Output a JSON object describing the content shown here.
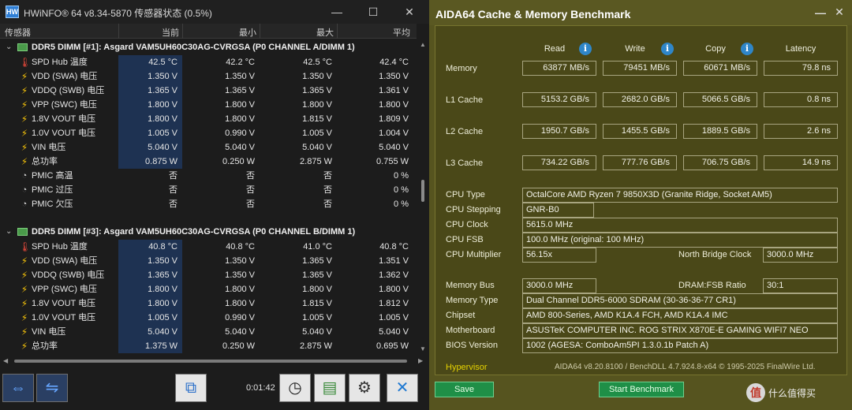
{
  "hwinfo": {
    "title": "HWiNFO® 64 v8.34-5870 传感器状态 (0.5%)",
    "logo_text": "HW",
    "window_controls": [
      "—",
      "☐",
      "✕"
    ],
    "columns": [
      "传感器",
      "当前",
      "最小",
      "最大",
      "平均"
    ],
    "groups": [
      {
        "toggle": "⌄",
        "name": "DDR5 DIMM [#1]: Asgard VAM5UH60C30AG-CVRGSA (P0 CHANNEL A/DIMM 1)",
        "rows": [
          {
            "icon": "thermometer-icon",
            "label": "SPD Hub 温度",
            "cur": "42.5 °C",
            "min": "42.2 °C",
            "max": "42.5 °C",
            "avg": "42.4 °C"
          },
          {
            "icon": "bolt-icon",
            "label": "VDD (SWA) 电压",
            "cur": "1.350 V",
            "min": "1.350 V",
            "max": "1.350 V",
            "avg": "1.350 V"
          },
          {
            "icon": "bolt-icon",
            "label": "VDDQ (SWB) 电压",
            "cur": "1.365 V",
            "min": "1.365 V",
            "max": "1.365 V",
            "avg": "1.361 V"
          },
          {
            "icon": "bolt-icon",
            "label": "VPP (SWC) 电压",
            "cur": "1.800 V",
            "min": "1.800 V",
            "max": "1.800 V",
            "avg": "1.800 V"
          },
          {
            "icon": "bolt-icon",
            "label": "1.8V VOUT 电压",
            "cur": "1.800 V",
            "min": "1.800 V",
            "max": "1.815 V",
            "avg": "1.809 V"
          },
          {
            "icon": "bolt-icon",
            "label": "1.0V VOUT 电压",
            "cur": "1.005 V",
            "min": "0.990 V",
            "max": "1.005 V",
            "avg": "1.004 V"
          },
          {
            "icon": "bolt-icon",
            "label": "VIN 电压",
            "cur": "5.040 V",
            "min": "5.040 V",
            "max": "5.040 V",
            "avg": "5.040 V"
          },
          {
            "icon": "bolt-icon",
            "label": "总功率",
            "cur": "0.875 W",
            "min": "0.250 W",
            "max": "2.875 W",
            "avg": "0.755 W"
          },
          {
            "icon": "clock-icon",
            "label": "PMIC 高温",
            "cur": "否",
            "min": "否",
            "max": "否",
            "avg": "0 %"
          },
          {
            "icon": "clock-icon",
            "label": "PMIC 过压",
            "cur": "否",
            "min": "否",
            "max": "否",
            "avg": "0 %"
          },
          {
            "icon": "clock-icon",
            "label": "PMIC 欠压",
            "cur": "否",
            "min": "否",
            "max": "否",
            "avg": "0 %"
          }
        ]
      },
      {
        "toggle": "⌄",
        "name": "DDR5 DIMM [#3]: Asgard VAM5UH60C30AG-CVRGSA (P0 CHANNEL B/DIMM 1)",
        "rows": [
          {
            "icon": "thermometer-icon",
            "label": "SPD Hub 温度",
            "cur": "40.8 °C",
            "min": "40.8 °C",
            "max": "41.0 °C",
            "avg": "40.8 °C"
          },
          {
            "icon": "bolt-icon",
            "label": "VDD (SWA) 电压",
            "cur": "1.350 V",
            "min": "1.350 V",
            "max": "1.365 V",
            "avg": "1.351 V"
          },
          {
            "icon": "bolt-icon",
            "label": "VDDQ (SWB) 电压",
            "cur": "1.365 V",
            "min": "1.350 V",
            "max": "1.365 V",
            "avg": "1.362 V"
          },
          {
            "icon": "bolt-icon",
            "label": "VPP (SWC) 电压",
            "cur": "1.800 V",
            "min": "1.800 V",
            "max": "1.800 V",
            "avg": "1.800 V"
          },
          {
            "icon": "bolt-icon",
            "label": "1.8V VOUT 电压",
            "cur": "1.800 V",
            "min": "1.800 V",
            "max": "1.815 V",
            "avg": "1.812 V"
          },
          {
            "icon": "bolt-icon",
            "label": "1.0V VOUT 电压",
            "cur": "1.005 V",
            "min": "0.990 V",
            "max": "1.005 V",
            "avg": "1.005 V"
          },
          {
            "icon": "bolt-icon",
            "label": "VIN 电压",
            "cur": "5.040 V",
            "min": "5.040 V",
            "max": "5.040 V",
            "avg": "5.040 V"
          },
          {
            "icon": "bolt-icon",
            "label": "总功率",
            "cur": "1.375 W",
            "min": "0.250 W",
            "max": "2.875 W",
            "avg": "0.695 W"
          }
        ]
      }
    ],
    "timer": "0:01:42",
    "toolbar": [
      "expand-arrows-icon",
      "collapse-arrows-icon",
      "network-icon",
      "stopwatch-icon",
      "add-report-icon",
      "settings-gear-icon",
      "close-x-icon"
    ]
  },
  "aida": {
    "title": "AIDA64 Cache & Memory Benchmark",
    "window_controls": [
      "—",
      "✕"
    ],
    "headers": [
      "Read",
      "Write",
      "Copy",
      "Latency"
    ],
    "info_glyph": "i",
    "bench": [
      {
        "label": "Memory",
        "read": "63877 MB/s",
        "write": "79451 MB/s",
        "copy": "60671 MB/s",
        "latency": "79.8 ns"
      },
      {
        "label": "L1 Cache",
        "read": "5153.2 GB/s",
        "write": "2682.0 GB/s",
        "copy": "5066.5 GB/s",
        "latency": "0.8 ns"
      },
      {
        "label": "L2 Cache",
        "read": "1950.7 GB/s",
        "write": "1455.5 GB/s",
        "copy": "1889.5 GB/s",
        "latency": "2.6 ns"
      },
      {
        "label": "L3 Cache",
        "read": "734.22 GB/s",
        "write": "777.76 GB/s",
        "copy": "706.75 GB/s",
        "latency": "14.9 ns"
      }
    ],
    "info": {
      "cpu_type_label": "CPU Type",
      "cpu_type": "OctalCore AMD Ryzen 7 9850X3D  (Granite Ridge, Socket AM5)",
      "cpu_stepping_label": "CPU Stepping",
      "cpu_stepping": "GNR-B0",
      "cpu_clock_label": "CPU Clock",
      "cpu_clock": "5615.0 MHz",
      "cpu_fsb_label": "CPU FSB",
      "cpu_fsb": "100.0 MHz  (original: 100 MHz)",
      "cpu_mult_label": "CPU Multiplier",
      "cpu_mult": "56.15x",
      "nb_clock_label": "North Bridge Clock",
      "nb_clock": "3000.0 MHz",
      "mem_bus_label": "Memory Bus",
      "mem_bus": "3000.0 MHz",
      "dram_fsb_label": "DRAM:FSB Ratio",
      "dram_fsb": "30:1",
      "mem_type_label": "Memory Type",
      "mem_type": "Dual Channel DDR5-6000 SDRAM  (30-36-36-77 CR1)",
      "chipset_label": "Chipset",
      "chipset": "AMD 800-Series, AMD K1A.4 FCH, AMD K1A.4 IMC",
      "mobo_label": "Motherboard",
      "mobo": "ASUSTeK COMPUTER INC. ROG STRIX X870E-E GAMING WIFI7 NEO",
      "bios_label": "BIOS Version",
      "bios": "1002  (AGESA: ComboAm5PI 1.3.0.1b Patch A)"
    },
    "hypervisor": "Hypervisor",
    "version": "AIDA64 v8.20.8100 / BenchDLL 4.7.924.8-x64  © 1995-2025 FinalWire Ltd.",
    "save_label": "Save",
    "start_label": "Start Benchmark",
    "watermark_icon": "值",
    "watermark": "什么值得买"
  }
}
